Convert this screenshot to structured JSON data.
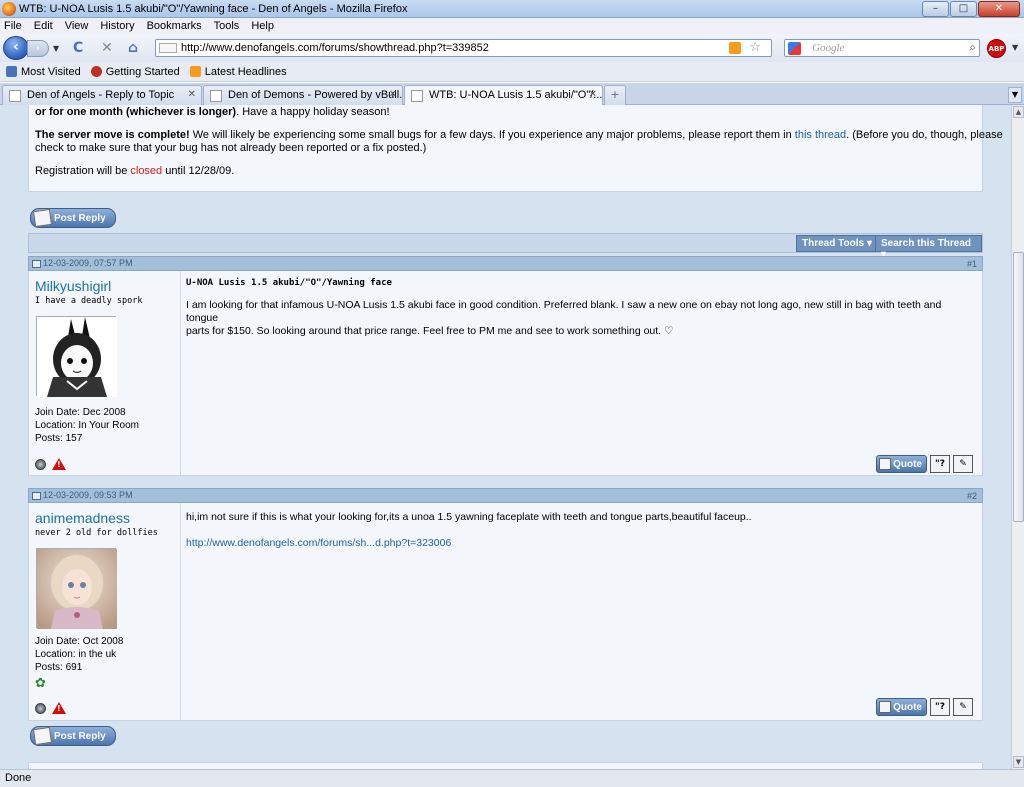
{
  "window": {
    "title": "WTB: U-NOA Lusis 1.5 akubi/\"O\"/Yawning face - Den of Angels - Mozilla Firefox",
    "min_label": "–",
    "max_label": "□",
    "close_label": "✕"
  },
  "menu": [
    "File",
    "Edit",
    "View",
    "History",
    "Bookmarks",
    "Tools",
    "Help"
  ],
  "nav": {
    "url": "http://www.denofangels.com/forums/showthread.php?t=339852",
    "search_placeholder": "Google",
    "abp_label": "ABP"
  },
  "bookmarks": [
    {
      "label": "Most Visited",
      "color": "#4a74b8"
    },
    {
      "label": "Getting Started",
      "color": "#c0311f"
    },
    {
      "label": "Latest Headlines",
      "color": "#f79a1e"
    }
  ],
  "tabs": [
    {
      "label": "Den of Angels - Reply to Topic"
    },
    {
      "label": "Den of Demons - Powered by vBull..."
    },
    {
      "label": "WTB: U-NOA Lusis 1.5 akubi/\"O\"/..."
    }
  ],
  "announcement": {
    "line1_bold": "or for one month (whichever is longer)",
    "line1_rest": ". Have a happy holiday season!",
    "line2_bold": "The server move is complete!",
    "line2_rest": " We will likely be experiencing some small bugs for a few days. If you experience any major problems, please report them in ",
    "line2_link": "this thread",
    "line2_end": ". (Before you do, though, please",
    "line3": "check to make sure that your bug has not already been reported or a fix posted.)",
    "line4_start": "Registration will be ",
    "line4_red": "closed",
    "line4_end": " until 12/28/09."
  },
  "post_reply_label": "Post Reply",
  "thread_tools_label": "Thread Tools ▾",
  "search_thread_label": "Search this Thread ▾",
  "posts": [
    {
      "date": "12-03-2009, 07:57 PM",
      "number": "#1",
      "username": "Milkyushigirl",
      "user_title": "I have a deadly spork",
      "join_date": "Join Date: Dec 2008",
      "location": "Location: In Your Room",
      "posts": "Posts: 157",
      "title": "U-NOA Lusis 1.5 akubi/\"O\"/Yawning face",
      "message_line1": "I am looking for that infamous U-NOA Lusis 1.5 akubi face in good condition. Preferred blank. I saw a new one on ebay not long ago, new still in bag with teeth and tongue",
      "message_line2": "parts for $150. So looking around that price range. Feel free to PM me and see to work something out. ♡",
      "quote_label": "Quote"
    },
    {
      "date": "12-03-2009, 09:53 PM",
      "number": "#2",
      "username": "animemadness",
      "user_title": "never 2 old for dollfies",
      "join_date": "Join Date: Oct 2008",
      "location": "Location: in the uk",
      "posts": "Posts: 691",
      "message_line1": "hi,im not sure if this is what your looking for,its a unoa 1.5 yawning faceplate with teeth and tongue parts,beautiful faceup..",
      "link": "http://www.denofangels.com/forums/sh...d.php?t=323006",
      "quote_label": "Quote"
    }
  ],
  "status": "Done"
}
